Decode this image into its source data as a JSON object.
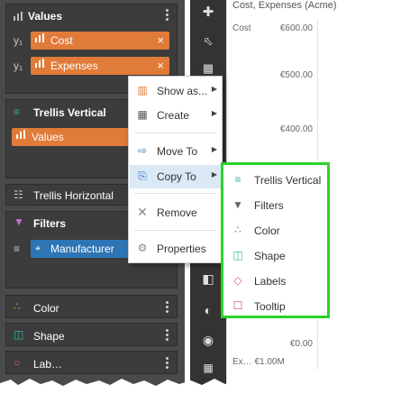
{
  "values_section": {
    "title": "Values",
    "icon": "bar-chart-icon",
    "axis_label_1": "y₁",
    "axis_label_2": "y₁",
    "fields": [
      {
        "label": "Cost",
        "close": "×"
      },
      {
        "label": "Expenses",
        "close": "×"
      }
    ]
  },
  "trellis_vertical": {
    "title": "Trellis Vertical",
    "field": "Values"
  },
  "trellis_horizontal": {
    "title": "Trellis Horizontal"
  },
  "filters_section": {
    "title": "Filters",
    "field": "Manufacturer"
  },
  "color_section": {
    "title": "Color"
  },
  "shape_section": {
    "title": "Shape"
  },
  "labels_section": {
    "title": "Lab…"
  },
  "context_menu": {
    "items": [
      {
        "label": "Show as...",
        "icon": "show-as-icon",
        "arrow": "▶"
      },
      {
        "label": "Create",
        "icon": "create-icon",
        "arrow": "▶"
      },
      {
        "label": "Move To",
        "icon": "move-to-icon",
        "arrow": "▶"
      },
      {
        "label": "Copy To",
        "icon": "copy-to-icon",
        "arrow": "▶"
      },
      {
        "label": "Remove",
        "icon": "remove-icon"
      },
      {
        "label": "Properties",
        "icon": "properties-icon"
      }
    ]
  },
  "submenu": {
    "items": [
      {
        "label": "Trellis Vertical",
        "icon": "trellis-vertical-icon"
      },
      {
        "label": "Filters",
        "icon": "filter-icon"
      },
      {
        "label": "Color",
        "icon": "color-icon"
      },
      {
        "label": "Shape",
        "icon": "shape-icon"
      },
      {
        "label": "Labels",
        "icon": "labels-icon"
      },
      {
        "label": "Tooltip",
        "icon": "tooltip-icon"
      }
    ]
  },
  "chart": {
    "title": "Cost, Expenses (Acme)",
    "series_label": "Cost",
    "yticks": [
      "€600.00",
      "€500.00",
      "€400.00",
      "€0.00"
    ],
    "footer": "Ex…         €1.00M"
  },
  "colors": {
    "panel_bg": "#4a4a4a",
    "section_bg": "#3c3c3c",
    "pill_orange": "#e07b39",
    "pill_blue": "#2e75b6",
    "highlight_green": "#2ad32a",
    "menu_active": "#dbe8f6"
  }
}
